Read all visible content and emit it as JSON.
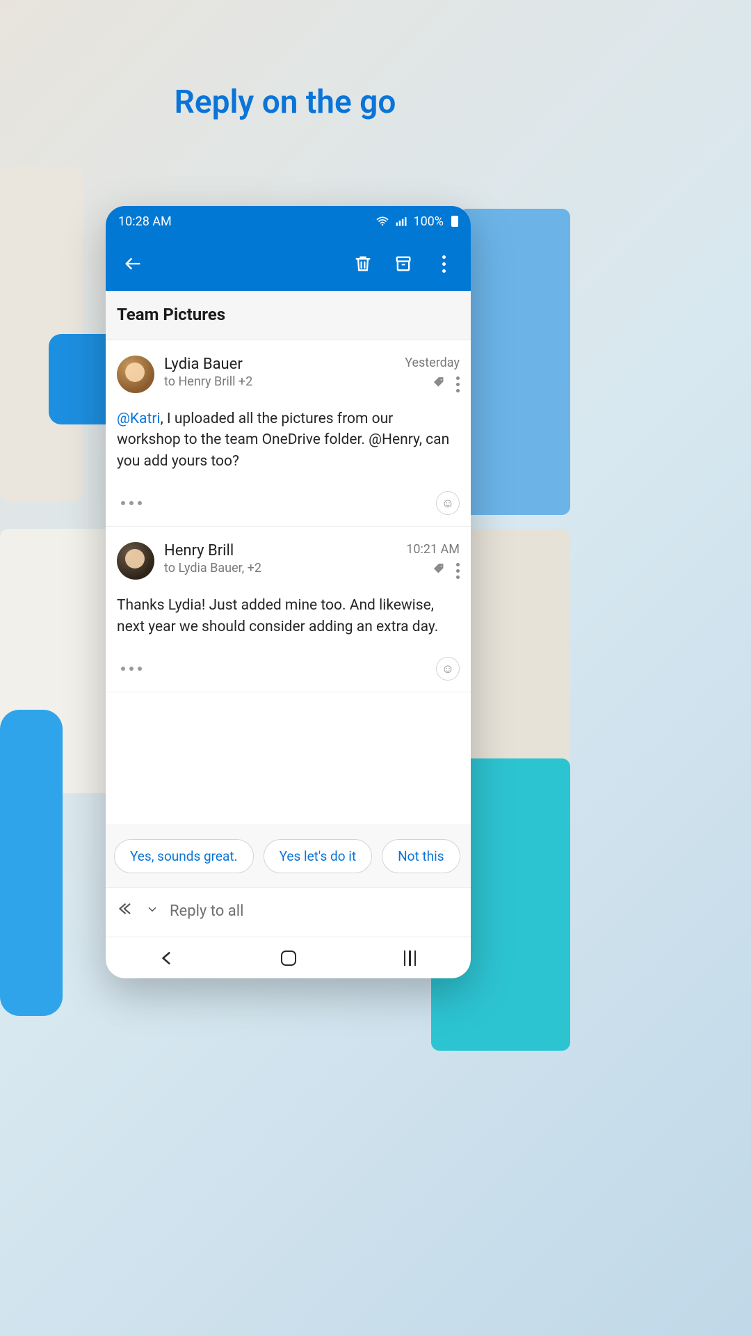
{
  "headline": "Reply on the go",
  "status": {
    "time": "10:28 AM",
    "battery": "100%"
  },
  "subject": "Team Pictures",
  "messages": [
    {
      "sender": "Lydia Bauer",
      "to": "to Henry Brill +2",
      "time": "Yesterday",
      "mention": "@Katri",
      "body_after_mention": ", I uploaded all the pictures from our workshop to the team OneDrive folder. @Henry, can you add yours too?"
    },
    {
      "sender": "Henry Brill",
      "to": "to Lydia Bauer, +2",
      "time": "10:21 AM",
      "body": "Thanks Lydia! Just added mine too. And likewise, next year we should consider adding an extra day."
    }
  ],
  "suggestions": [
    "Yes, sounds great.",
    "Yes let's do it",
    "Not this"
  ],
  "reply_placeholder": "Reply to all"
}
